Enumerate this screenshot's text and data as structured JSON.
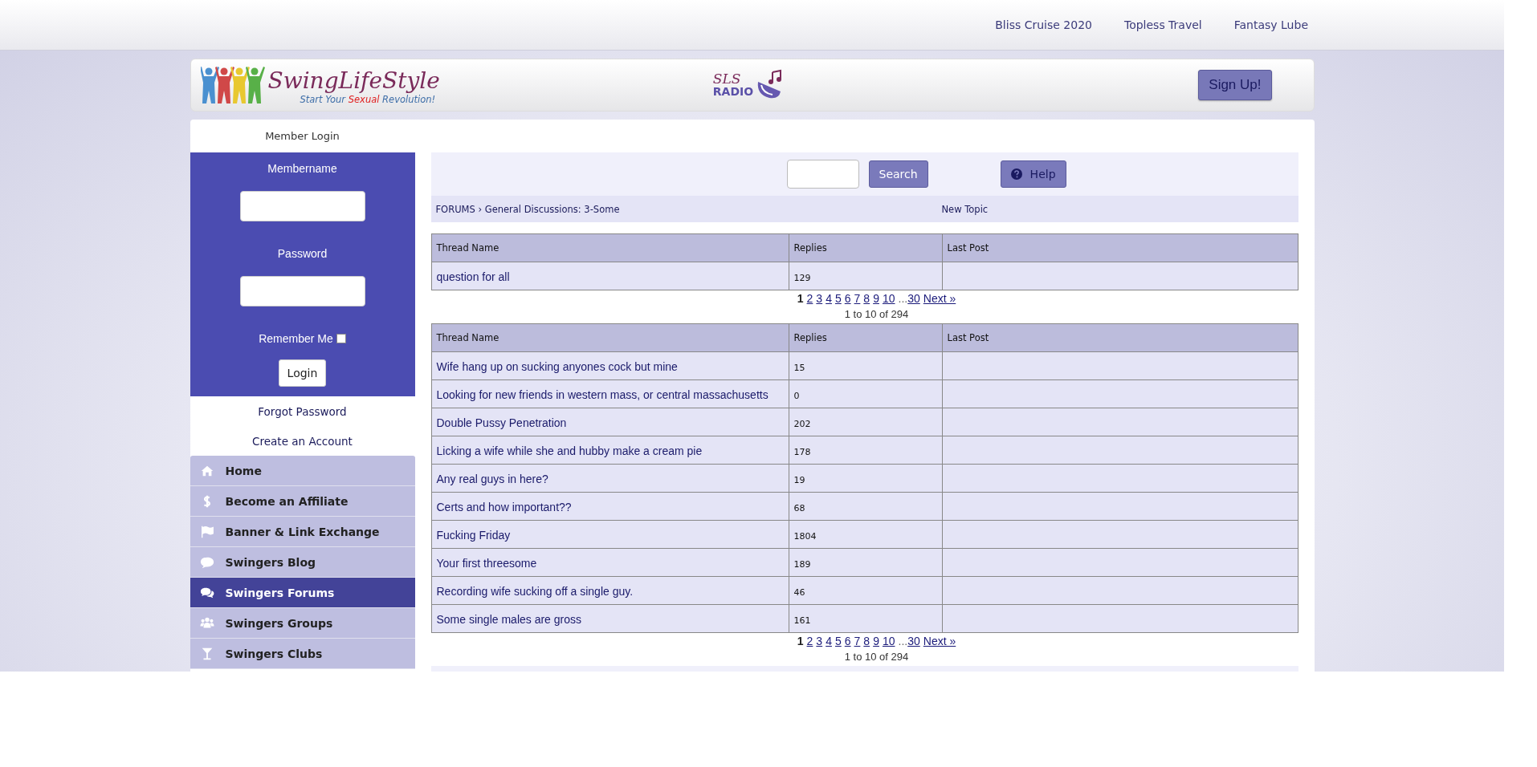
{
  "top_links": [
    "Bliss Cruise 2020",
    "Topless Travel",
    "Fantasy Lube"
  ],
  "header": {
    "logo": {
      "title": "SwingLifeStyle",
      "tagline": [
        {
          "text": "Start Your ",
          "kind": "plain"
        },
        {
          "text": "Sexual",
          "kind": "highlight"
        },
        {
          "text": " Revolution!",
          "kind": "plain"
        }
      ]
    },
    "radio_logo": {
      "top": "SLS",
      "bottom": "RADIO"
    },
    "signup_button": "Sign Up!"
  },
  "login": {
    "title": "Member Login",
    "membername_label": "Membername",
    "password_label": "Password",
    "remember_label": "Remember Me",
    "remember_checked": false,
    "login_button": "Login",
    "forgot_link": "Forgot Password",
    "create_link": "Create an Account"
  },
  "nav": [
    {
      "label": "Home",
      "selected": false
    },
    {
      "label": "Become an Affiliate",
      "selected": false
    },
    {
      "label": "Banner & Link Exchange",
      "selected": false
    },
    {
      "label": "Swingers Blog",
      "selected": false
    },
    {
      "label": "Swingers Forums",
      "selected": true
    },
    {
      "label": "Swingers Groups",
      "selected": false
    },
    {
      "label": "Swingers Clubs",
      "selected": false
    }
  ],
  "toolbar": {
    "search_button": "Search",
    "help_button": "Help"
  },
  "breadcrumb": {
    "root": "FORUMS",
    "separator": "›",
    "current": "General Discussions: 3-Some",
    "new_topic": "New Topic"
  },
  "sticky_table": {
    "columns": [
      "Thread Name",
      "Replies",
      "Last Post"
    ],
    "rows": [
      {
        "thread": "question for all",
        "replies": "129"
      }
    ]
  },
  "pagination_top": {
    "current": "1",
    "links": [
      "2",
      "3",
      "4",
      "5",
      "6",
      "7",
      "8",
      "9",
      "10"
    ],
    "gap": "...",
    "last": "30",
    "next": "Next »",
    "count": "1 to 10 of 294"
  },
  "thread_table": {
    "columns": [
      "Thread Name",
      "Replies",
      "Last Post"
    ],
    "rows": [
      {
        "thread": "Wife hang up on sucking anyones cock but mine",
        "replies": "15"
      },
      {
        "thread": "Looking for new friends in western mass, or central massachusetts",
        "replies": "0"
      },
      {
        "thread": "Double Pussy Penetration",
        "replies": "202"
      },
      {
        "thread": "Licking a wife while she and hubby make a cream pie",
        "replies": "178"
      },
      {
        "thread": "Any real guys in here?",
        "replies": "19"
      },
      {
        "thread": "Certs and how important??",
        "replies": "68"
      },
      {
        "thread": "Fucking Friday",
        "replies": "1804"
      },
      {
        "thread": "Your first threesome",
        "replies": "189"
      },
      {
        "thread": "Recording wife sucking off a single guy.",
        "replies": "46"
      },
      {
        "thread": "Some single males are gross",
        "replies": "161"
      }
    ]
  },
  "pagination_bottom": {
    "current": "1",
    "links": [
      "2",
      "3",
      "4",
      "5",
      "6",
      "7",
      "8",
      "9",
      "10"
    ],
    "gap": "...",
    "last": "30",
    "next": "Next »",
    "count": "1 to 10 of 294"
  }
}
